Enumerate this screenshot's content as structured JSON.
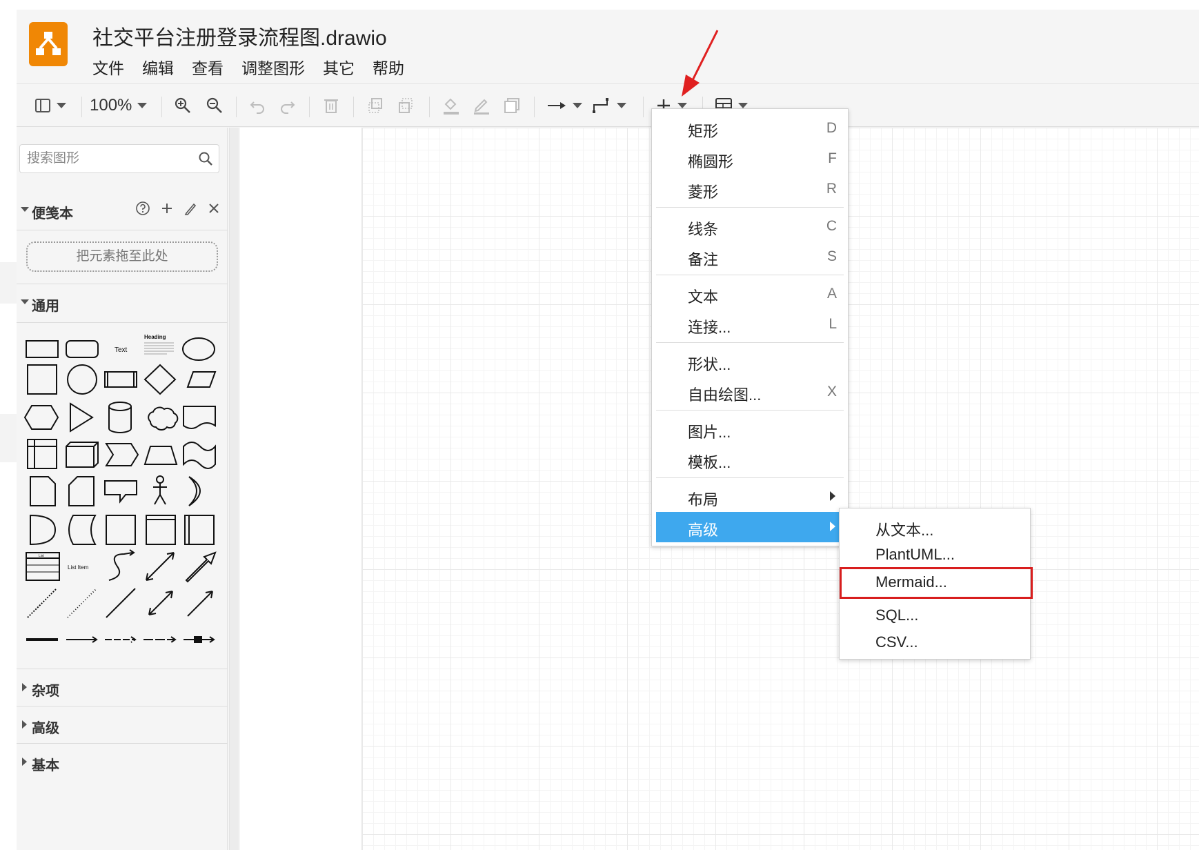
{
  "app": {
    "title": "社交平台注册登录流程图.drawio",
    "brand_color": "#f08705"
  },
  "menubar": [
    "文件",
    "编辑",
    "查看",
    "调整图形",
    "其它",
    "帮助"
  ],
  "toolbar": {
    "zoom": "100%"
  },
  "sidebar": {
    "search_placeholder": "搜索图形",
    "scratchpad": {
      "title": "便笺本",
      "dropzone": "把元素拖至此处"
    },
    "sections": {
      "general": "通用",
      "misc": "杂项",
      "advanced": "高级",
      "basic": "基本"
    },
    "shape_labels": {
      "text": "Text",
      "heading": "Heading",
      "list_item": "List Item",
      "list": "List"
    }
  },
  "insert_menu": {
    "items": [
      {
        "label": "矩形",
        "key": "D"
      },
      {
        "label": "椭圆形",
        "key": "F"
      },
      {
        "label": "菱形",
        "key": "R"
      },
      {
        "label": "线条",
        "key": "C"
      },
      {
        "label": "备注",
        "key": "S"
      },
      {
        "label": "文本",
        "key": "A"
      },
      {
        "label": "连接...",
        "key": "L"
      },
      {
        "label": "形状...",
        "key": ""
      },
      {
        "label": "自由绘图...",
        "key": "X"
      },
      {
        "label": "图片...",
        "key": ""
      },
      {
        "label": "模板...",
        "key": ""
      },
      {
        "label": "布局",
        "key": ""
      },
      {
        "label": "高级",
        "key": ""
      }
    ],
    "active_color": "#3ea8ee"
  },
  "advanced_submenu": {
    "items": [
      "从文本...",
      "PlantUML...",
      "Mermaid...",
      "SQL...",
      "CSV..."
    ],
    "highlighted": "Mermaid...",
    "highlight_color": "#d81e1e"
  }
}
